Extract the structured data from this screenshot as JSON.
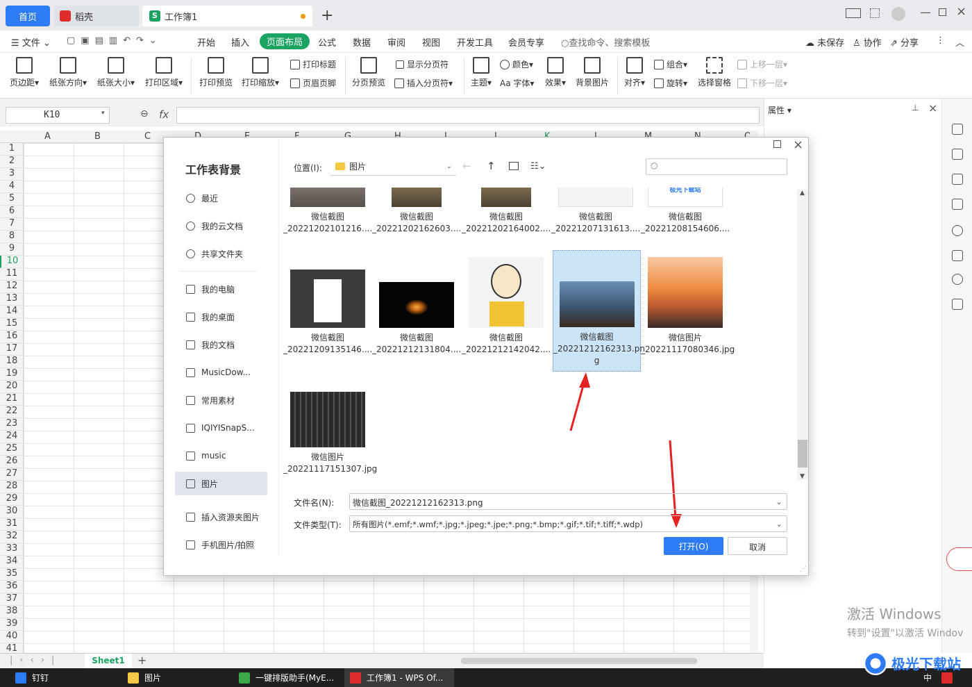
{
  "tabs": {
    "home": "首页",
    "daoke": "稻壳",
    "workbook": "工作簿1"
  },
  "menu": {
    "file": "文件",
    "start": "开始",
    "insert": "插入",
    "page_layout": "页面布局",
    "formula": "公式",
    "data": "数据",
    "review": "审阅",
    "view": "视图",
    "dev": "开发工具",
    "member": "会员专享",
    "search": "查找命令、搜索模板",
    "unsaved": "未保存",
    "collab": "协作",
    "share": "分享"
  },
  "ribbon": {
    "margins": "页边距",
    "orientation": "纸张方向",
    "size": "纸张大小",
    "print_area": "打印区域",
    "print_preview": "打印预览",
    "print_zoom": "打印缩放",
    "print_titles": "打印标题",
    "header_footer": "页眉页脚",
    "page_break_preview": "分页预览",
    "show_breaks": "显示分页符",
    "insert_break": "插入分页符",
    "theme": "主题",
    "colors": "颜色",
    "fonts": "Aa 字体",
    "effects": "效果",
    "bg_image": "背景图片",
    "align": "对齐",
    "group": "组合",
    "rotate": "旋转",
    "select_pane": "选择窗格",
    "bring_forward": "上移一层",
    "send_backward": "下移一层"
  },
  "formula_bar": {
    "cell_ref": "K10",
    "fx": "fx"
  },
  "properties_label": "属性",
  "columns": [
    "A",
    "B",
    "C",
    "D",
    "E",
    "F",
    "G",
    "H",
    "I",
    "J",
    "K",
    "L",
    "M",
    "N",
    "O"
  ],
  "rows": [
    "1",
    "2",
    "3",
    "4",
    "5",
    "6",
    "7",
    "8",
    "9",
    "10",
    "11",
    "12",
    "13",
    "14",
    "15",
    "16",
    "17",
    "18",
    "19",
    "20",
    "21",
    "22",
    "23",
    "24",
    "25",
    "26",
    "27",
    "28",
    "29",
    "30",
    "31",
    "32",
    "33",
    "34",
    "35",
    "36",
    "37",
    "38",
    "39",
    "40",
    "41"
  ],
  "sheet_tab": "Sheet1",
  "dialog": {
    "title": "工作表背景",
    "location_label": "位置(I):",
    "location_value": "图片",
    "sidebar": [
      "最近",
      "我的云文档",
      "共享文件夹",
      "我的电脑",
      "我的桌面",
      "我的文档",
      "MusicDow...",
      "常用素材",
      "IQIYISnapS...",
      "music",
      "图片",
      "插入资源夹图片",
      "手机图片/拍照"
    ],
    "files_row1": [
      {
        "l1": "微信截图",
        "l2": "_20221202101216...."
      },
      {
        "l1": "微信截图",
        "l2": "_20221202162603...."
      },
      {
        "l1": "微信截图",
        "l2": "_20221202164002...."
      },
      {
        "l1": "微信截图",
        "l2": "_20221207131613...."
      },
      {
        "l1": "微信截图",
        "l2": "_20221208154606...."
      }
    ],
    "files_row2": [
      {
        "l1": "微信截图",
        "l2": "_20221209135146...."
      },
      {
        "l1": "微信截图",
        "l2": "_20221212131804...."
      },
      {
        "l1": "微信截图",
        "l2": "_20221212142042...."
      },
      {
        "l1": "微信截图",
        "l2": "_20221212162313.pn",
        "l3": "g"
      },
      {
        "l1": "微信图片",
        "l2": "_20221117080346.jpg"
      }
    ],
    "files_row3": [
      {
        "l1": "微信图片",
        "l2": "_20221117151307.jpg"
      }
    ],
    "thumb_badge": "极光下载站",
    "filename_label": "文件名(N):",
    "filename_value": "微信截图_20221212162313.png",
    "filetype_label": "文件类型(T):",
    "filetype_value": "所有图片(*.emf;*.wmf;*.jpg;*.jpeg;*.jpe;*.png;*.bmp;*.gif;*.tif;*.tiff;*.wdp)",
    "open": "打开(O)",
    "cancel": "取消"
  },
  "watermark": {
    "line1": "激活 Windows",
    "line2": "转到\"设置\"以激活 Windov"
  },
  "taskbar": {
    "dingtalk": "钉钉",
    "pictures": "图片",
    "helper": "一键排版助手(MyE...",
    "wps": "工作簿1 - WPS Of...",
    "ime": "中"
  },
  "brand_watermark": "极光下载站",
  "colors": {
    "accent": "#2d7cf6",
    "green": "#1aa361",
    "arrow": "#e52222"
  }
}
